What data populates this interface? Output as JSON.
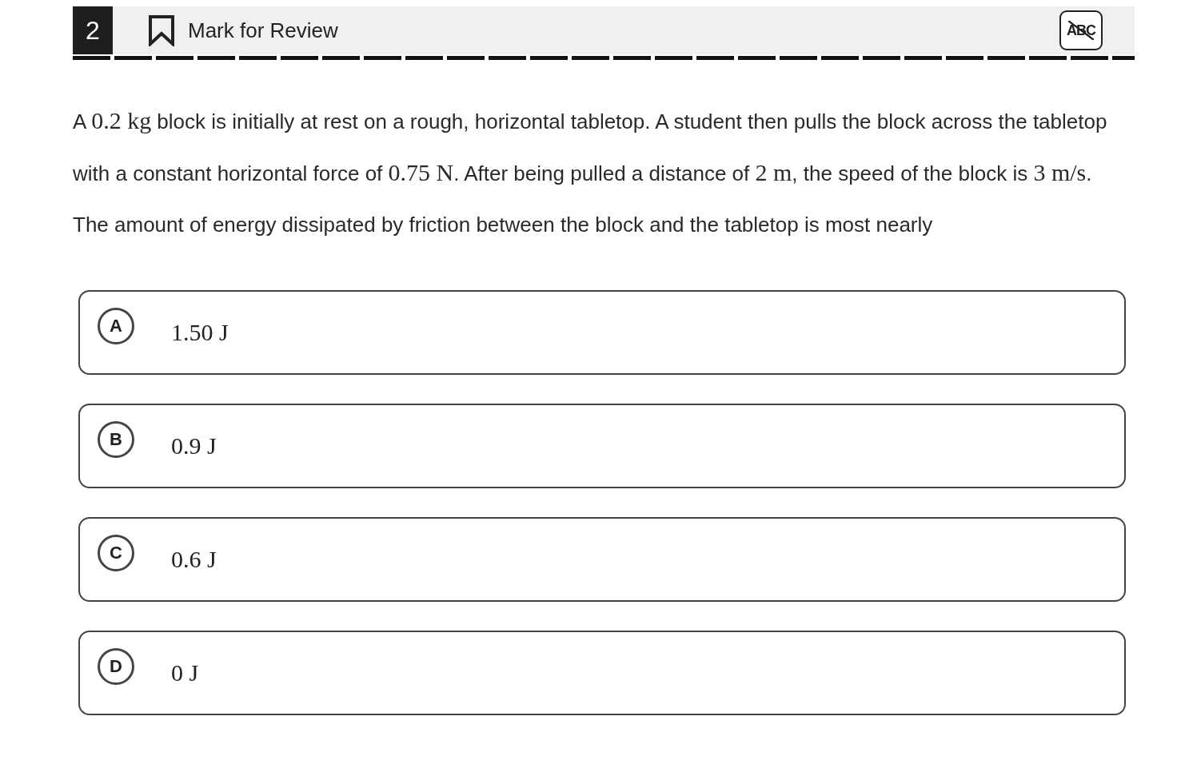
{
  "header": {
    "question_number": "2",
    "mark_for_review": {
      "label": "Mark for Review",
      "checked": false
    },
    "eliminator": {
      "label": "ABC"
    }
  },
  "question": [
    {
      "kind": "text",
      "text": "A "
    },
    {
      "kind": "math",
      "text": "0.2 kg"
    },
    {
      "kind": "text",
      "text": " block is initially at rest on a rough, horizontal tabletop. A student then pulls the block across the tabletop with a constant horizontal force of "
    },
    {
      "kind": "math",
      "text": "0.75 N"
    },
    {
      "kind": "text",
      "text": ". After being pulled a distance of "
    },
    {
      "kind": "math",
      "text": "2 m"
    },
    {
      "kind": "text",
      "text": ", the speed of the block is "
    },
    {
      "kind": "math",
      "text": "3 m/s"
    },
    {
      "kind": "text",
      "text": ". The amount of energy dissipated by friction between the block and the tabletop is most nearly"
    }
  ],
  "options": [
    {
      "letter": "A",
      "answer": "1.50 J"
    },
    {
      "letter": "B",
      "answer": "0.9 J"
    },
    {
      "letter": "C",
      "answer": "0.6 J"
    },
    {
      "letter": "D",
      "answer": "0 J"
    }
  ]
}
